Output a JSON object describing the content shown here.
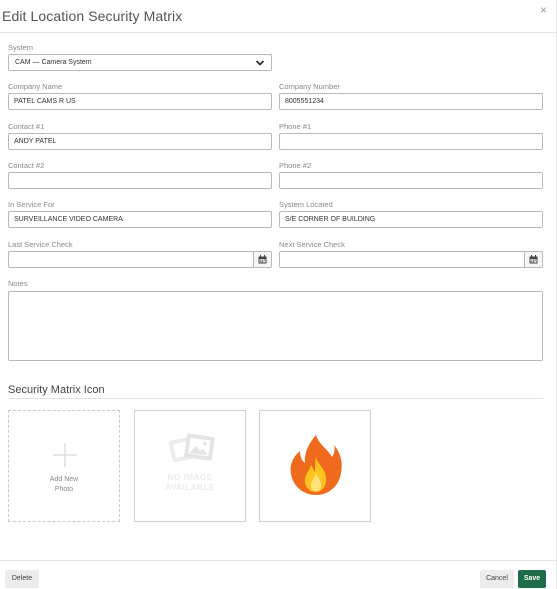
{
  "dialog": {
    "title": "Edit Location Security Matrix",
    "close_icon": "×"
  },
  "fields": {
    "system": {
      "label": "System",
      "value": "CAM — Camera System"
    },
    "company_name": {
      "label": "Company Name",
      "value": "PATEL CAMS R US"
    },
    "company_number": {
      "label": "Company Number",
      "value": "8005551234"
    },
    "contact1": {
      "label": "Contact #1",
      "value": "ANDY PATEL"
    },
    "phone1": {
      "label": "Phone #1",
      "value": ""
    },
    "contact2": {
      "label": "Contact #2",
      "value": ""
    },
    "phone2": {
      "label": "Phone #2",
      "value": ""
    },
    "in_service_for": {
      "label": "In Service For",
      "value": "SURVEILLANCE VIDEO CAMERA"
    },
    "system_located": {
      "label": "System Located",
      "value": "S/E CORNER OF BUILDING"
    },
    "last_service_check": {
      "label": "Last Service Check",
      "value": ""
    },
    "next_service_check": {
      "label": "Next Service Check",
      "value": ""
    },
    "notes": {
      "label": "Notes",
      "value": ""
    }
  },
  "icon_section": {
    "title": "Security Matrix Icon",
    "add_new_line1": "Add New",
    "add_new_line2": "Photo",
    "no_image_line1": "NO IMAGE",
    "no_image_line2": "AVAILABLE"
  },
  "footer": {
    "delete_label": "Delete",
    "cancel_label": "Cancel",
    "save_label": "Save"
  },
  "colors": {
    "save": "#1e6b47",
    "fire_outer": "#f06a1e",
    "fire_inner": "#ffc21f"
  }
}
